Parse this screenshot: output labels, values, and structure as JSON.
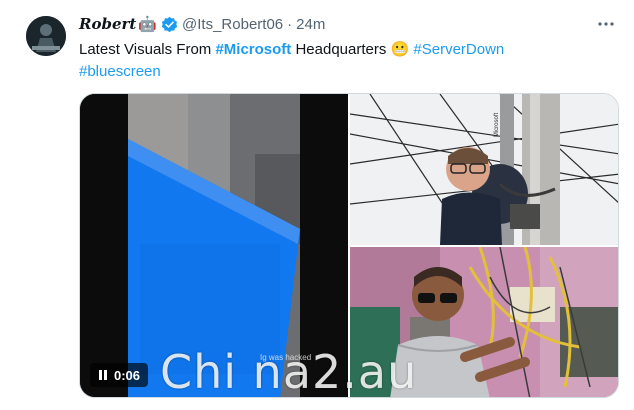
{
  "user": {
    "display_name": "Robert",
    "name_emoji": "🤖",
    "handle": "@Its_Robert06",
    "separator": "·",
    "time": "24m"
  },
  "tweet": {
    "text_prefix": "Latest Visuals From ",
    "tag_microsoft": "#Microsoft",
    "text_mid": " Headquarters ",
    "emoji": "😬",
    "tag_serverdown": "#ServerDown",
    "tag_bluescreen": "#bluescreen"
  },
  "video": {
    "duration": "0:06",
    "caption": "Ig    was hacked"
  },
  "photo_top": {
    "pole_text": "Microsoft"
  },
  "watermark": "Chi  na2.au",
  "colors": {
    "link": "#1d9bf0",
    "secondary": "#536471",
    "verified": "#1d9bf0"
  }
}
